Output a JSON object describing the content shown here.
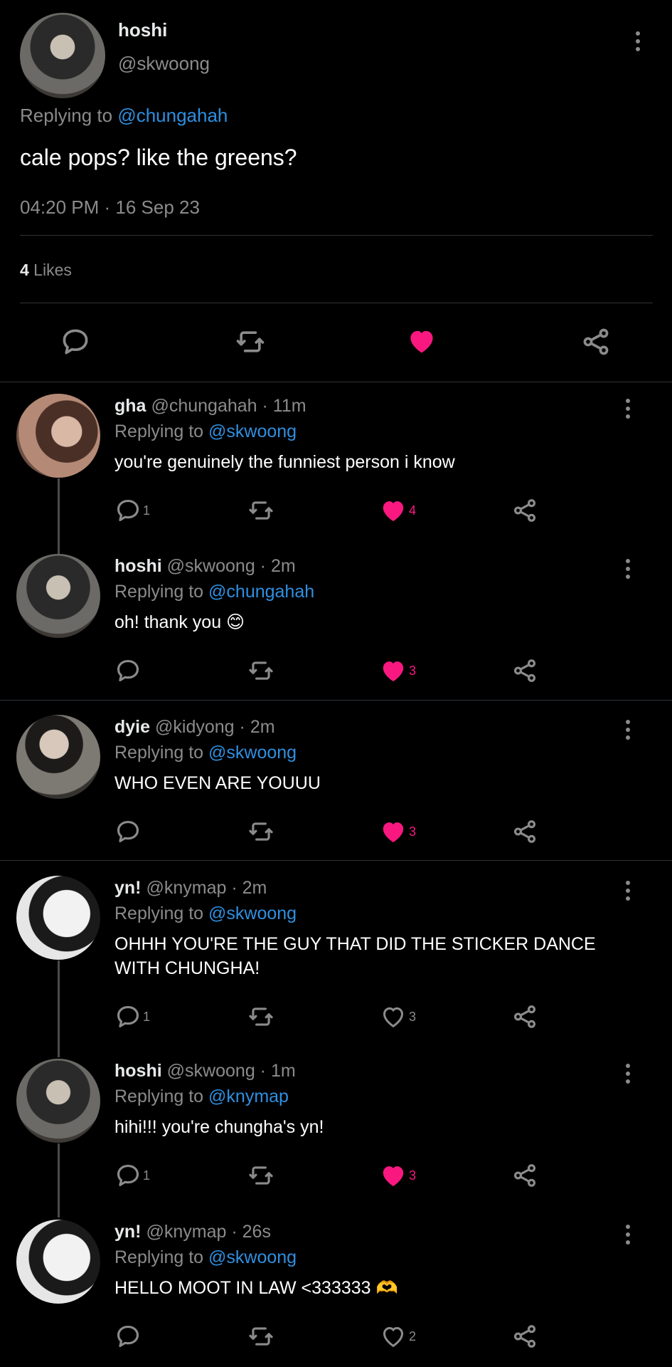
{
  "main": {
    "name": "hoshi",
    "handle": "@skwoong",
    "replying_prefix": "Replying to ",
    "replying_handle": "@chungahah",
    "text": "cale pops? like the greens?",
    "time": "04:20 PM",
    "separator": " · ",
    "date": "16 Sep 23",
    "likes_count": "4",
    "likes_label": " Likes"
  },
  "replies": [
    {
      "name": "gha",
      "handle": "@chungahah",
      "sep": " · ",
      "time": "11m",
      "replying_prefix": "Replying to ",
      "replying_to": "@skwoong",
      "text": "you're genuinely the funniest person i know",
      "reply_count": "1",
      "like_count": "4",
      "liked": true
    },
    {
      "name": "hoshi",
      "handle": "@skwoong",
      "sep": " · ",
      "time": "2m",
      "replying_prefix": "Replying to ",
      "replying_to": "@chungahah",
      "text": "oh! thank you 😊",
      "reply_count": "",
      "like_count": "3",
      "liked": true
    },
    {
      "name": "dyie",
      "handle": "@kidyong",
      "sep": " · ",
      "time": "2m",
      "replying_prefix": "Replying to ",
      "replying_to": "@skwoong",
      "text": "WHO EVEN ARE YOUUU",
      "reply_count": "",
      "like_count": "3",
      "liked": true
    },
    {
      "name": "yn!",
      "handle": "@knymap",
      "sep": " · ",
      "time": "2m",
      "replying_prefix": "Replying to ",
      "replying_to": "@skwoong",
      "text": "OHHH YOU'RE THE GUY THAT DID THE STICKER DANCE WITH CHUNGHA!",
      "reply_count": "1",
      "like_count": "3",
      "liked": false
    },
    {
      "name": "hoshi",
      "handle": "@skwoong",
      "sep": " · ",
      "time": "1m",
      "replying_prefix": "Replying to ",
      "replying_to": "@knymap",
      "text": "hihi!!! you're chungha's yn!",
      "reply_count": "1",
      "like_count": "3",
      "liked": true
    },
    {
      "name": "yn!",
      "handle": "@knymap",
      "sep": " · ",
      "time": "26s",
      "replying_prefix": "Replying to ",
      "replying_to": "@skwoong",
      "text": "HELLO MOOT IN LAW <333333 🫶",
      "reply_count": "",
      "like_count": "2",
      "liked": false
    }
  ],
  "colors": {
    "background": "#000000",
    "text": "#e7e9ea",
    "muted": "#8b8b8b",
    "link": "#2f8fe0",
    "like": "#f91880",
    "divider": "#2f3336"
  },
  "icons": [
    "more-icon",
    "reply-icon",
    "retweet-icon",
    "like-icon",
    "share-icon"
  ]
}
